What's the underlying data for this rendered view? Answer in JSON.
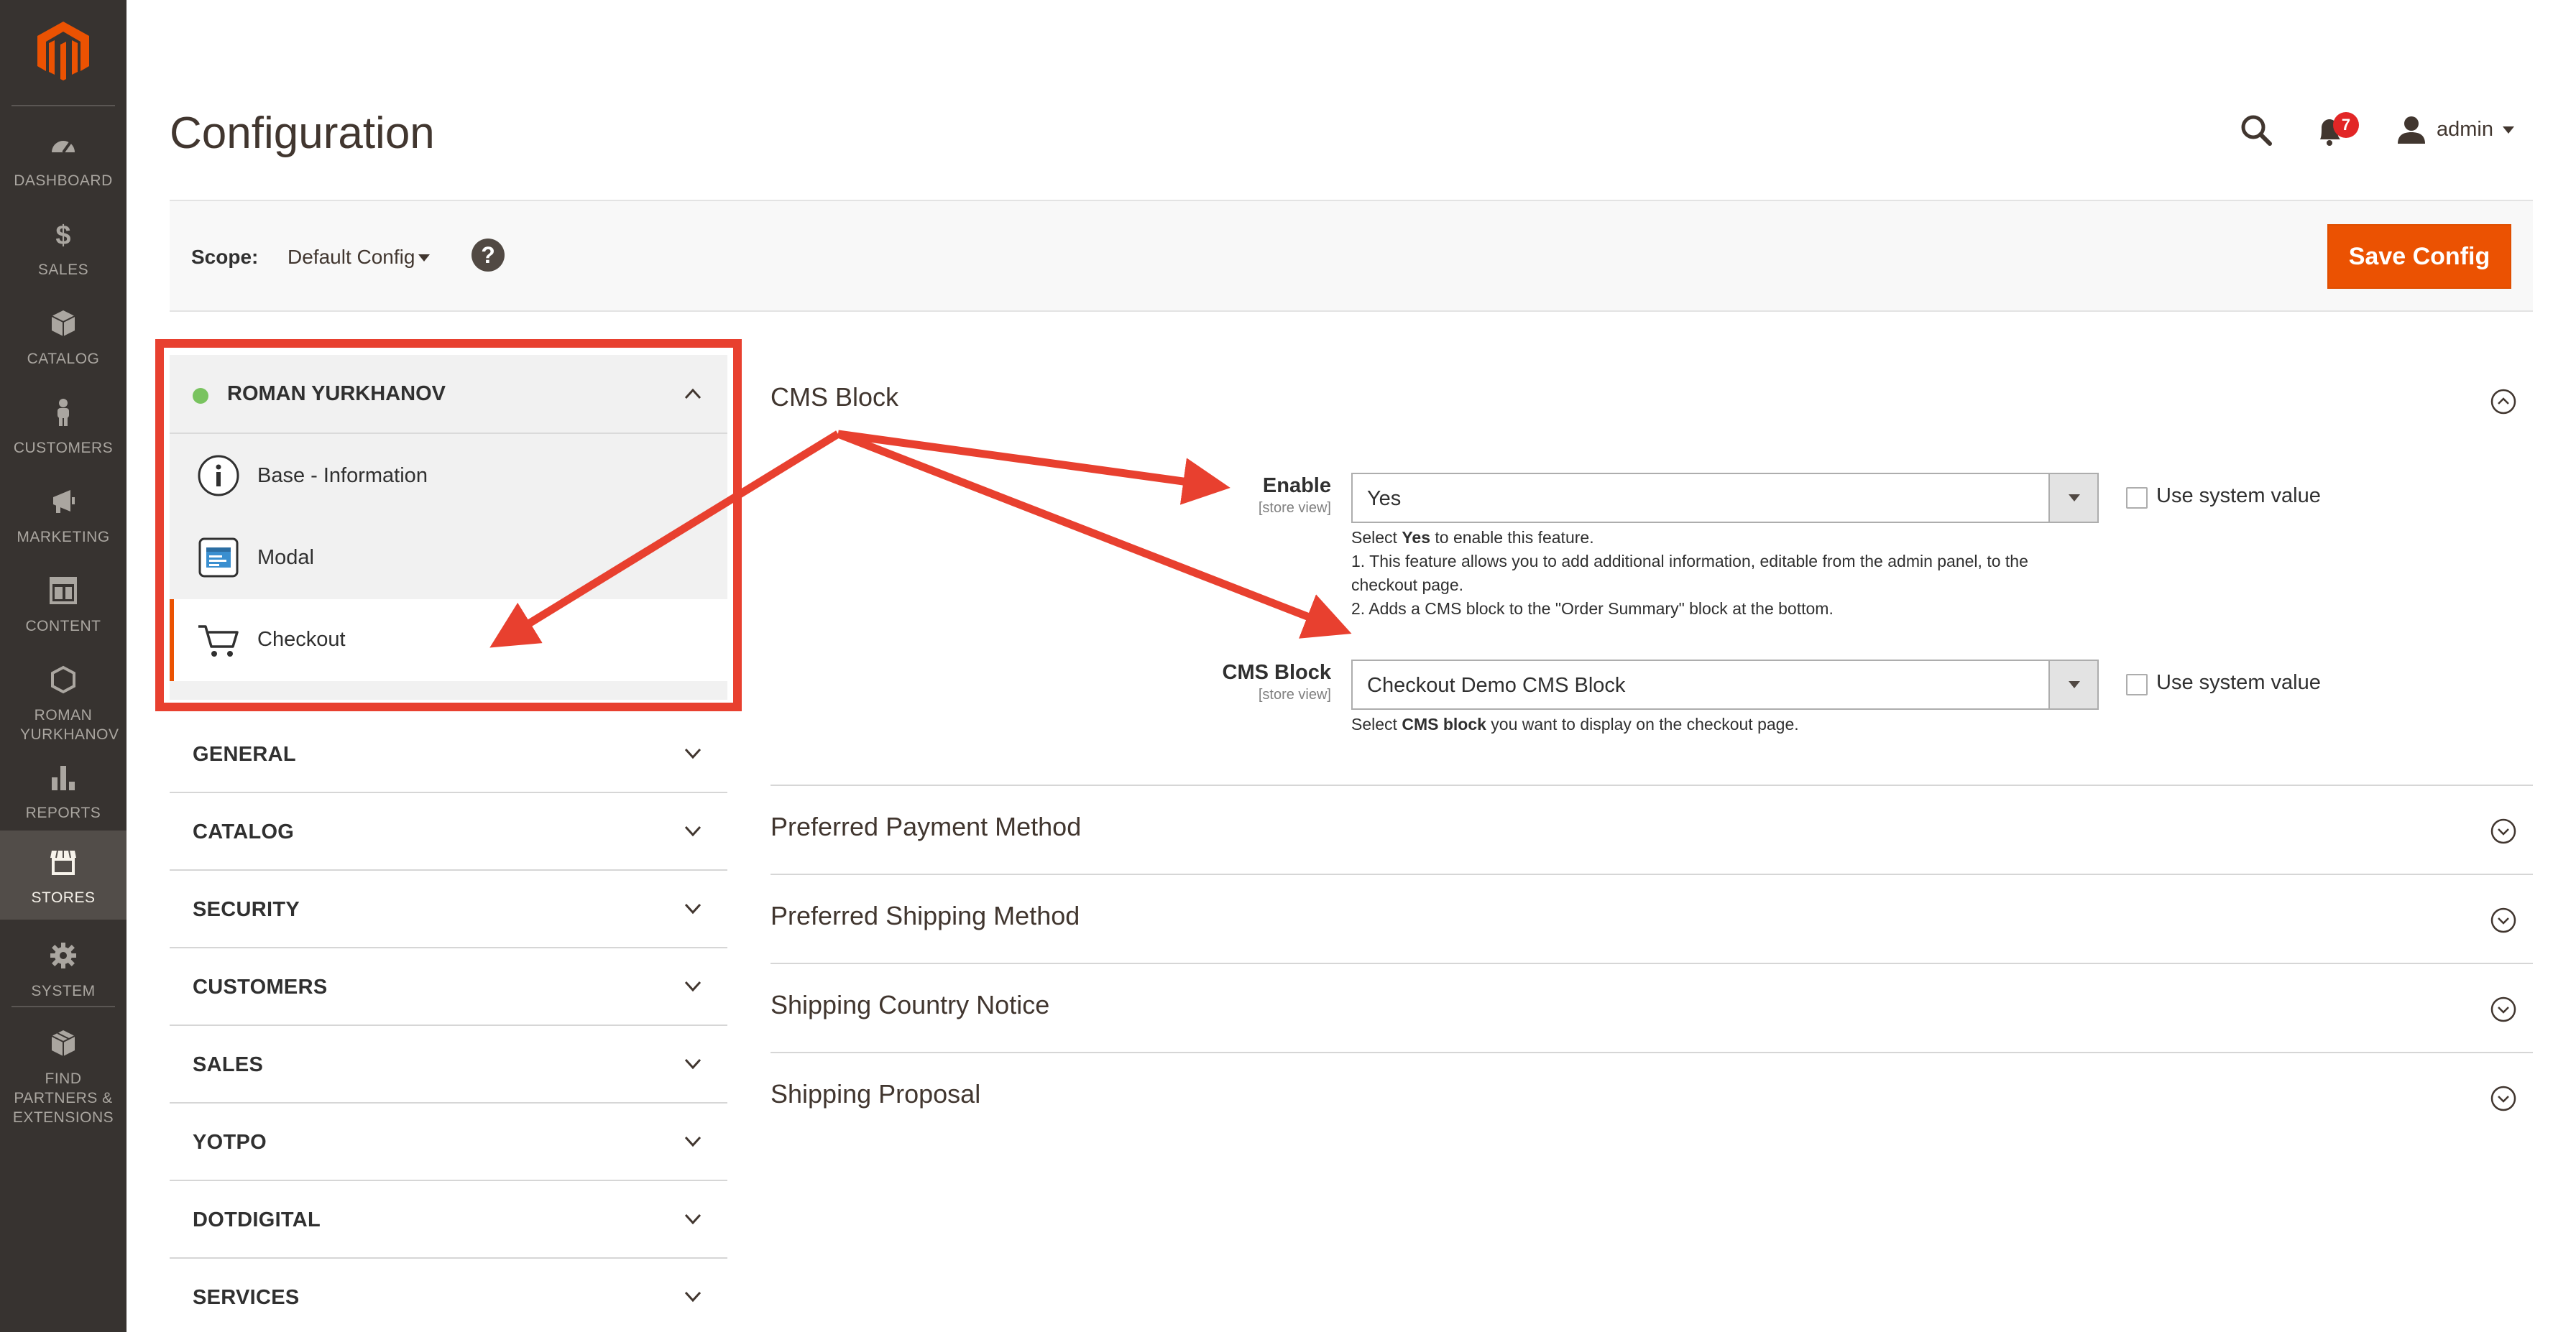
{
  "menu": {
    "items": [
      {
        "label": "DASHBOARD",
        "icon": "dashboard-icon"
      },
      {
        "label": "$",
        "icon": "dollar-icon",
        "sub": "SALES"
      },
      {
        "label": "CATALOG",
        "icon": "box-icon"
      },
      {
        "label": "CUSTOMERS",
        "icon": "person-icon"
      },
      {
        "label": "MARKETING",
        "icon": "megaphone-icon"
      },
      {
        "label": "CONTENT",
        "icon": "layout-icon"
      },
      {
        "label": "ROMAN YURKHANOV",
        "icon": "hexagon-icon"
      },
      {
        "label": "REPORTS",
        "icon": "bar-chart-icon"
      },
      {
        "label": "STORES",
        "icon": "store-icon"
      },
      {
        "label": "SYSTEM",
        "icon": "gear-icon"
      },
      {
        "label": "FIND PARTNERS & EXTENSIONS",
        "icon": "cubes-icon"
      }
    ],
    "active": "STORES"
  },
  "header": {
    "title": "Configuration",
    "notifications_count": "7",
    "user_name": "admin"
  },
  "scope": {
    "label": "Scope:",
    "value": "Default Config",
    "help": "?",
    "save_label": "Save Config"
  },
  "tabs": {
    "vendor": {
      "name": "ROMAN YURKHANOV",
      "items": [
        {
          "label": "Base - Information",
          "icon": "info-icon"
        },
        {
          "label": "Modal",
          "icon": "modal-window-icon"
        },
        {
          "label": "Checkout",
          "icon": "cart-icon",
          "active": true
        }
      ]
    },
    "sections": [
      "GENERAL",
      "CATALOG",
      "SECURITY",
      "CUSTOMERS",
      "SALES",
      "YOTPO",
      "DOTDIGITAL",
      "SERVICES"
    ]
  },
  "content": {
    "cms_block": {
      "title": "CMS Block",
      "enable": {
        "label": "Enable",
        "scope": "[store view]",
        "value": "Yes",
        "use_system": "Use system value",
        "note_prefix": "Select ",
        "note_bold": "Yes",
        "note_suffix": " to enable this feature.",
        "note_line1": "1. This feature allows you to add additional information, editable from the admin panel, to the checkout page.",
        "note_line2": "2. Adds a CMS block to the \"Order Summary\" block at the bottom."
      },
      "block": {
        "label": "CMS Block",
        "scope": "[store view]",
        "value": "Checkout Demo CMS Block",
        "use_system": "Use system value",
        "note_prefix": "Select ",
        "note_bold": "CMS block",
        "note_suffix": " you want to display on the checkout page."
      }
    },
    "collapsed_sections": [
      "Preferred Payment Method",
      "Preferred Shipping Method",
      "Shipping Country Notice",
      "Shipping Proposal"
    ]
  },
  "colors": {
    "accent": "#eb5202",
    "menu_bg": "#373330",
    "annotation": "#e8402f",
    "status_dot": "#79c35f",
    "badge": "#e22626"
  }
}
